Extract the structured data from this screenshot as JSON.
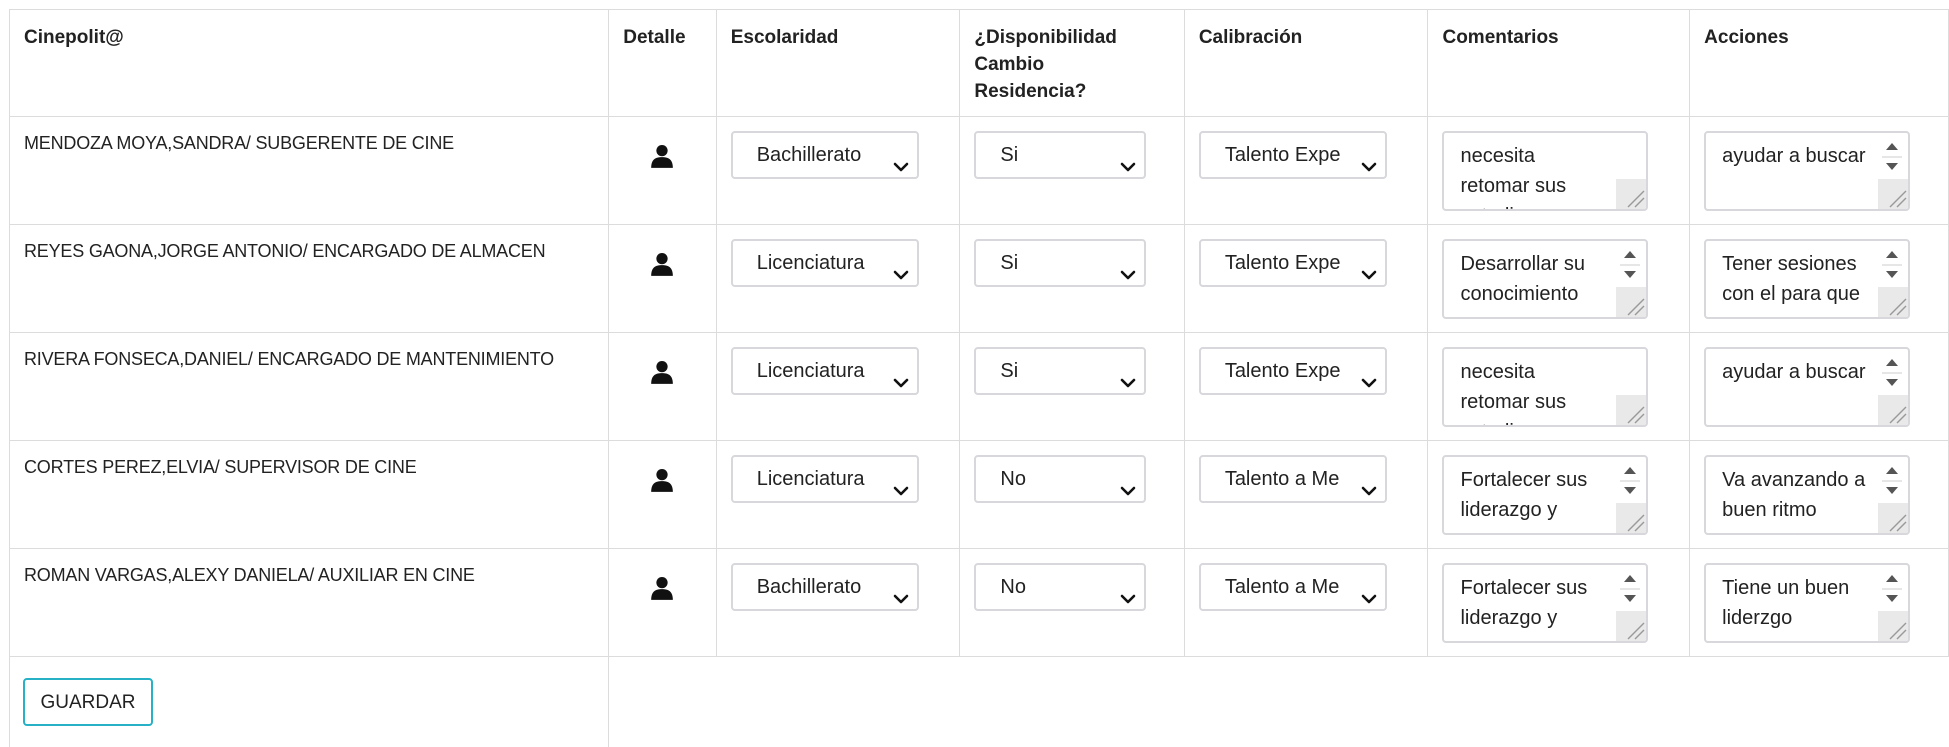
{
  "headers": {
    "cinepolit": "Cinepolit@",
    "detalle": "Detalle",
    "escolaridad": "Escolaridad",
    "disponibilidad": "¿Disponibilidad Cambio Residencia?",
    "calibracion": "Calibración",
    "comentarios": "Comentarios",
    "acciones": "Acciones"
  },
  "rows": [
    {
      "name": "MENDOZA MOYA,SANDRA/ SUBGERENTE DE CINE",
      "escolaridad": "Bachillerato",
      "disponibilidad": "Si",
      "calibracion": "Talento Expe",
      "comentarios": "necesita retomar sus estudios",
      "acciones": "ayudar a buscar"
    },
    {
      "name": "REYES GAONA,JORGE ANTONIO/ ENCARGADO DE ALMACEN",
      "escolaridad": "Licenciatura",
      "disponibilidad": "Si",
      "calibracion": "Talento Expe",
      "comentarios": "Desarrollar su conocimiento",
      "acciones": "Tener sesiones con el para que"
    },
    {
      "name": "RIVERA FONSECA,DANIEL/ ENCARGADO DE MANTENIMIENTO",
      "escolaridad": "Licenciatura",
      "disponibilidad": "Si",
      "calibracion": "Talento Expe",
      "comentarios": "necesita retomar sus estudios",
      "acciones": "ayudar a buscar"
    },
    {
      "name": "CORTES PEREZ,ELVIA/ SUPERVISOR DE CINE",
      "escolaridad": "Licenciatura",
      "disponibilidad": "No",
      "calibracion": "Talento a Me",
      "comentarios": "Fortalecer sus liderazgo y",
      "acciones": "Va avanzando a buen ritmo"
    },
    {
      "name": "ROMAN VARGAS,ALEXY DANIELA/ AUXILIAR EN CINE",
      "escolaridad": "Bachillerato",
      "disponibilidad": "No",
      "calibracion": "Talento a Me",
      "comentarios": "Fortalecer sus liderazgo y",
      "acciones": "Tiene un buen liderzgo"
    }
  ],
  "save_label": "GUARDAR",
  "icons": {
    "detail": "person-icon",
    "select": "chevron-down-icon",
    "spinner": "spinner-arrows-icon",
    "resize": "resize-grip-icon"
  },
  "colors": {
    "save_border": "#27b1c6",
    "grid_line": "#dcdcdc"
  }
}
